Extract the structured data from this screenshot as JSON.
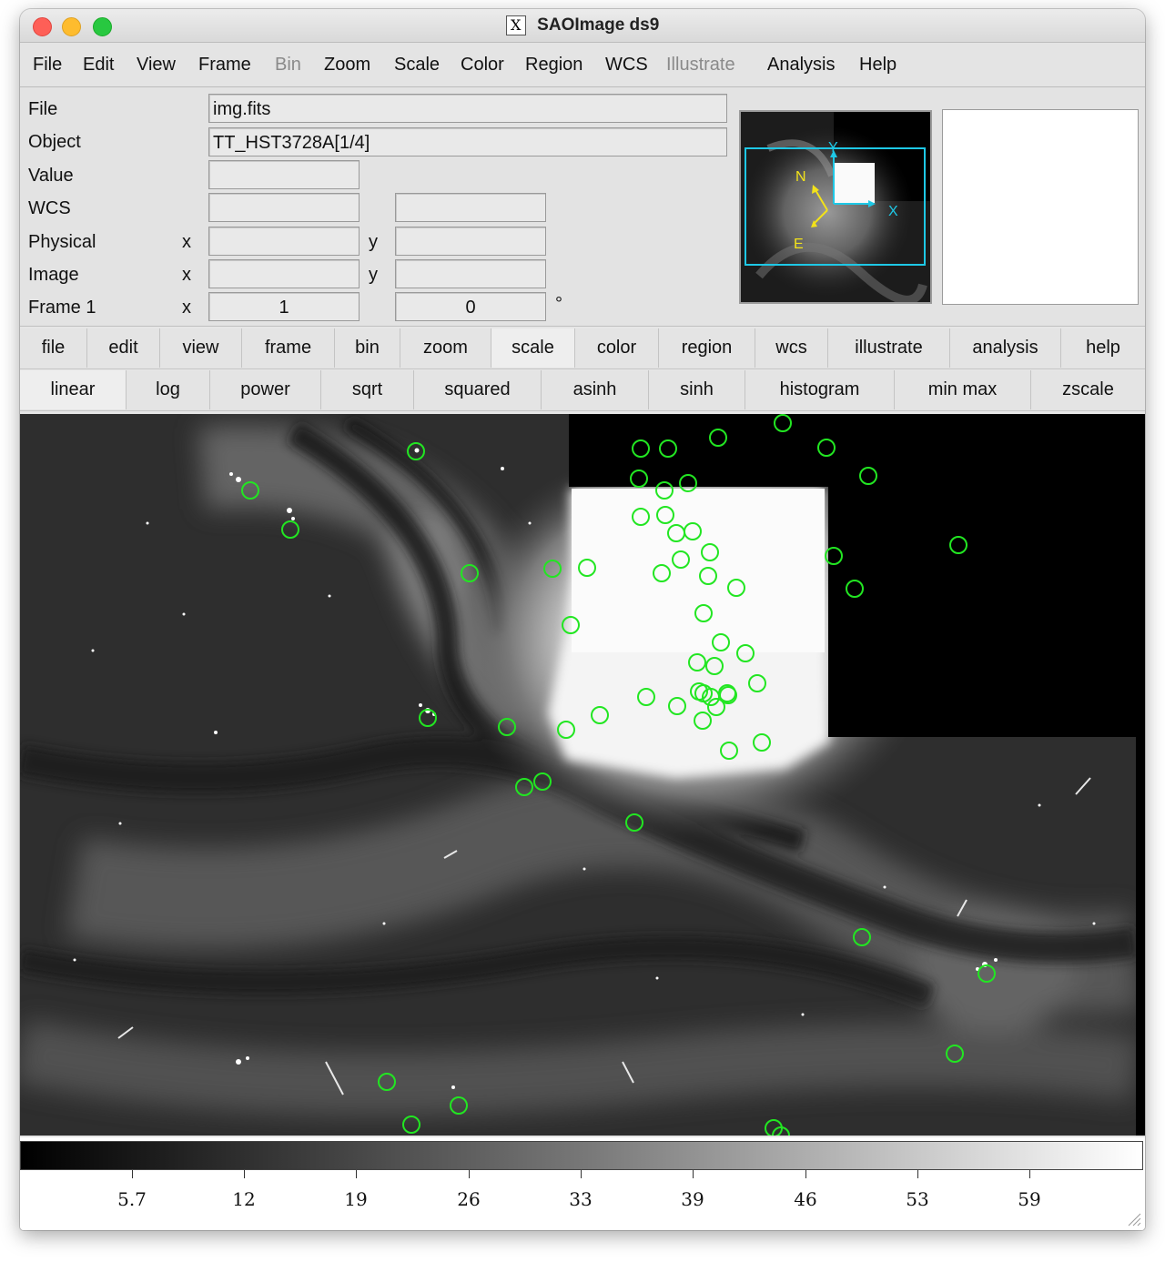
{
  "window": {
    "title": "SAOImage ds9",
    "title_icon": "x11-icon"
  },
  "menubar": [
    {
      "label": "File",
      "enabled": true
    },
    {
      "label": "Edit",
      "enabled": true
    },
    {
      "label": "View",
      "enabled": true
    },
    {
      "label": "Frame",
      "enabled": true
    },
    {
      "label": "Bin",
      "enabled": false
    },
    {
      "label": "Zoom",
      "enabled": true
    },
    {
      "label": "Scale",
      "enabled": true
    },
    {
      "label": "Color",
      "enabled": true
    },
    {
      "label": "Region",
      "enabled": true
    },
    {
      "label": "WCS",
      "enabled": true
    },
    {
      "label": "Illustrate",
      "enabled": false
    },
    {
      "label": "Analysis",
      "enabled": true
    },
    {
      "label": "Help",
      "enabled": true
    }
  ],
  "info": {
    "file_label": "File",
    "file_value": "img.fits",
    "object_label": "Object",
    "object_value": "TT_HST3728A[1/4]",
    "value_label": "Value",
    "value_value": "",
    "wcs_label": "WCS",
    "wcs_value1": "",
    "wcs_value2": "",
    "physical_label": "Physical",
    "physical_x_label": "x",
    "physical_x": "",
    "physical_y_label": "y",
    "physical_y": "",
    "image_label": "Image",
    "image_x_label": "x",
    "image_x": "",
    "image_y_label": "y",
    "image_y": "",
    "frame_label": "Frame 1",
    "frame_x_label": "x",
    "frame_x": "1",
    "frame_y": "0",
    "frame_unit": "°"
  },
  "panner": {
    "compass_n": "N",
    "compass_e": "E",
    "axis_x": "X",
    "axis_y": "Y",
    "compass_color": "#f2e21a",
    "axis_color": "#1ec8e6",
    "box_color": "#1ec8e6"
  },
  "buttonbar": {
    "active": "scale",
    "items": [
      "file",
      "edit",
      "view",
      "frame",
      "bin",
      "zoom",
      "scale",
      "color",
      "region",
      "wcs",
      "illustrate",
      "analysis",
      "help"
    ]
  },
  "scalebar": {
    "items": [
      "linear",
      "log",
      "power",
      "sqrt",
      "squared",
      "asinh",
      "sinh",
      "histogram",
      "min max",
      "zscale"
    ]
  },
  "regions": {
    "shape": "circle",
    "color": "#22e622",
    "count": 71
  },
  "colorbar": {
    "colormap": "grey",
    "labels": [
      "5.7",
      "12",
      "19",
      "26",
      "33",
      "39",
      "46",
      "53",
      "59"
    ]
  }
}
